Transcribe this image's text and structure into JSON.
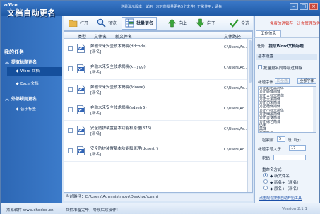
{
  "window": {
    "title_text": "这是演示版本：试用一次只能批量更名5个文件！正常使用，请先",
    "logo_small": "office",
    "logo_main": "文档自动更名"
  },
  "sidebar": {
    "title": "我的任务",
    "groups": [
      {
        "label": "提取标题更名",
        "items": [
          {
            "label": "Word 文档",
            "active": true
          },
          {
            "label": "Excel文档",
            "active": false
          }
        ]
      },
      {
        "label": "外部规则更名",
        "items": [
          {
            "label": "音乐标签",
            "active": false
          }
        ]
      }
    ]
  },
  "toolbar": {
    "open": "打开",
    "preview": "预览",
    "batch_rename": "批量更名",
    "up": "向上",
    "down": "向下",
    "select_all": "全选"
  },
  "table": {
    "headers": {
      "type": "类型",
      "filename": "文件名",
      "newname": "新文件名",
      "path": "文件路径"
    },
    "rows": [
      {
        "file": "奔驰未来安全技术揭晓(ddcode)",
        "newname": "[新名]",
        "path": "C:\\Users\\Ad..."
      },
      {
        "file": "奔驰未来安全技术揭晓(k..lygg)",
        "newname": "[新名]",
        "path": "C:\\Users\\Ad..."
      },
      {
        "file": "奔驰未来安全技术揭晓(fdoree)",
        "newname": "[新名]",
        "path": "C:\\Users\\Ad..."
      },
      {
        "file": "奔驰未来安全技术揭晓(sdsefr5)",
        "newname": "[新名]",
        "path": "C:\\Users\\Ad..."
      },
      {
        "file": "安全防护装置基本功能和原理(876)",
        "newname": "[新名]",
        "path": "C:\\Users\\Ad..."
      },
      {
        "file": "安全防护装置基本功能和原理(dcsertr)",
        "newname": "[新名]",
        "path": "C:\\Users\\Ad..."
      }
    ],
    "current_path_label": "当前路径：",
    "current_path": "C:\\Users\\Administrator\\Desktop\\ceshi"
  },
  "panel": {
    "promo": "免费的进销存一让你管理软件",
    "tab": "工作信息",
    "task_label": "任务：",
    "task_value": "提取Word文档标题",
    "basic_settings": "基本设置",
    "skip_chinese_label": "批量更名同等级过排除",
    "title_font_label": "标题字体",
    "btn_all": "同全选",
    "btn_all_fonts": "全部字体",
    "fonts": [
      "方正超粗黑简体",
      "方正姚体简体",
      "方正大标宋简体",
      "方正大黑简体",
      "方正仿宋简体",
      "方正楷体简体",
      "方正小标宋简体",
      "方正细黑简体",
      "方正隶变简体",
      "方正综艺简体",
      "仿宋",
      "黑体",
      "华文彩云",
      "华文仿宋"
    ],
    "search_before_label": "检索前",
    "search_before_value": "5",
    "search_unit": "段（行）",
    "title_size_label": "标题字号大于",
    "title_size_value": "17",
    "password_label": "密码",
    "rename_mode_label": "重命名方式",
    "modes": [
      {
        "label": "◆ 新文件名",
        "checked": true
      },
      {
        "label": "◆ 新名+（原名）",
        "checked": false
      },
      {
        "label": "◆ 原名+（新名）",
        "checked": false
      }
    ],
    "link": "点击观看搜索自动开始工具"
  },
  "statusbar": {
    "left": "杰易软件 www.shodoo.cn",
    "message": "文件准备完毕，等候后续操作！",
    "version": "Version 2.1.1"
  }
}
